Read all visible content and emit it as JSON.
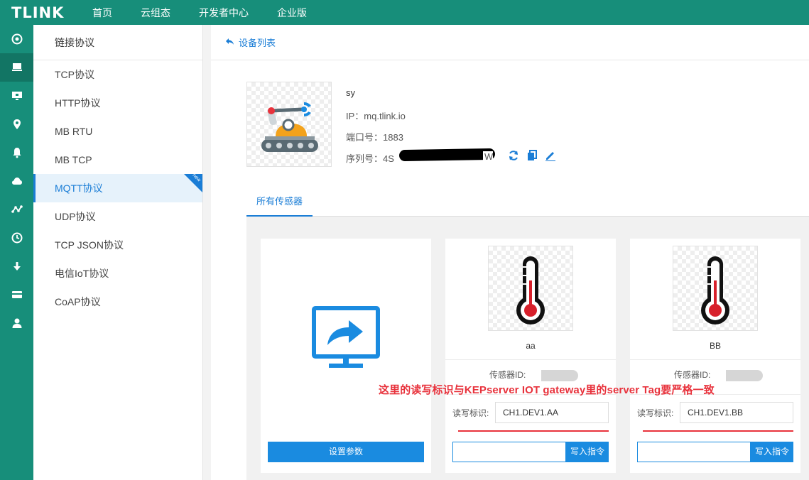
{
  "app": {
    "logo": "TLINK"
  },
  "topnav": [
    "首页",
    "云组态",
    "开发者中心",
    "企业版"
  ],
  "iconbar": [
    "target-icon",
    "monitor-stand-icon",
    "screen-icon",
    "location-pin-icon",
    "bell-icon",
    "cloud-icon",
    "network-icon",
    "clock-icon",
    "download-icon",
    "card-icon",
    "user-icon"
  ],
  "sidebar": {
    "title": "链接协议",
    "items": [
      {
        "label": "TCP协议"
      },
      {
        "label": "HTTP协议"
      },
      {
        "label": "MB  RTU"
      },
      {
        "label": "MB  TCP"
      },
      {
        "label": "MQTT协议",
        "active": true,
        "badge": "new"
      },
      {
        "label": "UDP协议"
      },
      {
        "label": "TCP  JSON协议"
      },
      {
        "label": "电信IoT协议"
      },
      {
        "label": "CoAP协议"
      }
    ]
  },
  "breadcrumb": {
    "back_icon": "back-arrow-icon",
    "label": "设备列表"
  },
  "device": {
    "name": "sy",
    "ip_label": "IP：",
    "ip": "mq.tlink.io",
    "port_label": "端口号：",
    "port": "1883",
    "serial_label": "序列号：",
    "serial_prefix": "4S",
    "serial_suffix": "W",
    "actions": [
      "refresh-icon",
      "copy-icon",
      "edit-icon"
    ]
  },
  "tabs": [
    {
      "label": "所有传感器",
      "active": true
    }
  ],
  "add_card": {
    "button_label": "设置参数"
  },
  "sensors": [
    {
      "name": "aa",
      "id_label": "传感器ID:",
      "rw_label": "读写标识:",
      "rw_value": "CH1.DEV1.AA",
      "cmd_button": "写入指令"
    },
    {
      "name": "BB",
      "id_label": "传感器ID:",
      "rw_label": "读写标识:",
      "rw_value": "CH1.DEV1.BB",
      "cmd_button": "写入指令"
    }
  ],
  "annotation": "这里的读写标识与KEPserver IOT gateway里的server Tag要严格一致",
  "colors": {
    "header": "#178e7a",
    "accent": "#1a8be0",
    "annotation": "#e8323c"
  }
}
